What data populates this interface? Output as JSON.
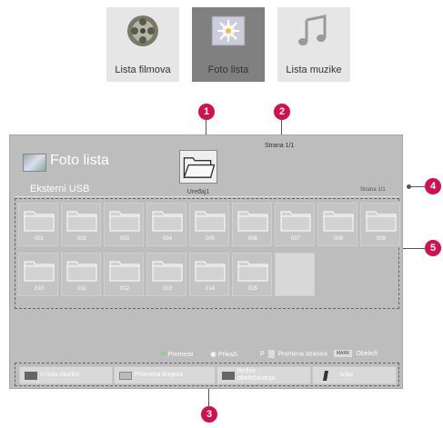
{
  "menu": {
    "tabs": [
      {
        "label": "Lista filmova",
        "icon": "film-reel-icon",
        "active": false
      },
      {
        "label": "Foto lista",
        "icon": "photo-icon",
        "active": true
      },
      {
        "label": "Lista muzike",
        "icon": "music-note-icon",
        "active": false
      }
    ]
  },
  "callouts": [
    "1",
    "2",
    "3",
    "4",
    "5"
  ],
  "screen": {
    "title": "Foto lista",
    "page_top": "Strana 1/1",
    "device_label": "Uređaj1",
    "source": "Eksterni USB",
    "page_right": "Strana 1/1",
    "folders": [
      "001",
      "002",
      "003",
      "004",
      "005",
      "006",
      "007",
      "008",
      "009",
      "010",
      "011",
      "012",
      "013",
      "014",
      "015"
    ],
    "hints": {
      "move": "Premesti",
      "view": "Prikaži",
      "page_key": "P",
      "page_change": "Promena stranice",
      "mark_key": "MARK",
      "mark": "Obeleži"
    },
    "buttons": [
      {
        "label": "U listu muzike"
      },
      {
        "label": "Promena brojeva"
      },
      {
        "label_1": "Režim",
        "label_2": "obeležavanja"
      },
      {
        "label": "Izlaz"
      }
    ]
  },
  "colors": {
    "callout": "#d2104e",
    "screen_bg": "#bdbdbd",
    "active_tab": "#808080"
  }
}
